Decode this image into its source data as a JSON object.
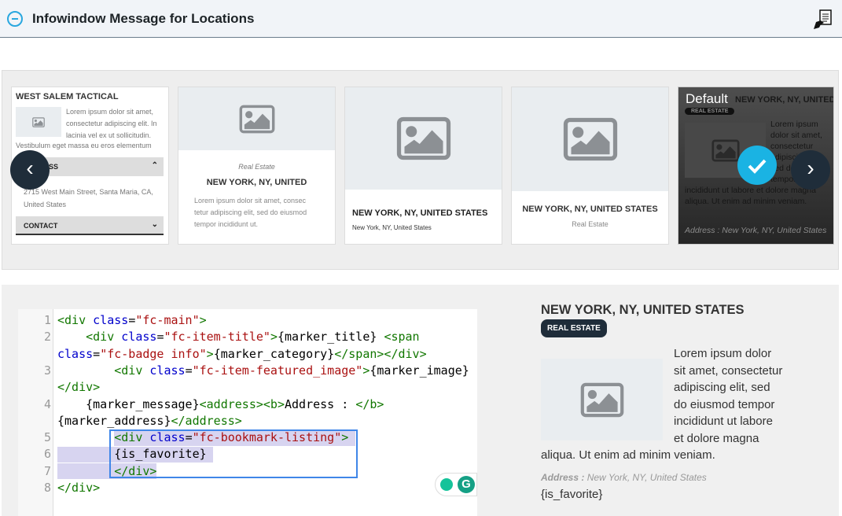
{
  "header": {
    "title": "Infowindow Message for Locations",
    "collapse_icon": "minus-circle-icon",
    "action_icon": "document-hand-icon"
  },
  "carousel": {
    "cards": [
      {
        "title": "WEST SALEM TACTICAL",
        "message": "Lorem ipsum dolor sit amet, consectetur adipiscing elit. In lacinia vel ex ut sollicitudin.",
        "message_cont": "Vestibulum eget massa eu eros elementum",
        "section1": "ADDRESS",
        "address": "2715 West Main Street, Santa Maria, CA, United States",
        "section2": "CONTACT"
      },
      {
        "category": "Real Estate",
        "title": "NEW YORK, NY, UNITED",
        "message": "Lorem ipsum dolor sit amet, consec tetur adipiscing elit, sed do eiusmod tempor incididunt ut."
      },
      {
        "title": "NEW YORK, NY, UNITED STATES",
        "address": "New York, NY, United States"
      },
      {
        "title": "NEW YORK, NY, UNITED STATES",
        "category": "Real Estate"
      },
      {
        "label": "Default",
        "title": "NEW YORK, NY, UNITED STATES",
        "badge": "REAL ESTATE",
        "message": "Lorem ipsum dolor sit amet, consectetur adipiscing elit, sed do eiusmod tempor incididunt ut labore et dolore magna aliqua. Ut enim ad minim veniam.",
        "address": "Address : New York, NY, United States",
        "selected": true
      }
    ],
    "prev_icon": "chevron-left-icon",
    "next_icon": "chevron-right-icon",
    "check_icon": "check-icon",
    "accent": "#1ab3e3"
  },
  "editor": {
    "lines": [
      {
        "n": "1",
        "rows": [
          [
            [
              "tg",
              "<div "
            ],
            [
              "at",
              "class"
            ],
            [
              "tx",
              "="
            ],
            [
              "st",
              "\"fc-main\""
            ],
            [
              "tg",
              ">"
            ]
          ]
        ]
      },
      {
        "n": "2",
        "rows": [
          [
            [
              "tx",
              "    "
            ],
            [
              "tg",
              "<div "
            ],
            [
              "at",
              "class"
            ],
            [
              "tx",
              "="
            ],
            [
              "st",
              "\"fc-item-title\""
            ],
            [
              "tg",
              ">"
            ],
            [
              "tx",
              "{marker_title} "
            ],
            [
              "tg",
              "<span"
            ]
          ],
          [
            [
              "at",
              "class"
            ],
            [
              "tx",
              "="
            ],
            [
              "st",
              "\"fc-badge info\""
            ],
            [
              "tg",
              ">"
            ],
            [
              "tx",
              "{marker_category}"
            ],
            [
              "tg",
              "</span></div>"
            ]
          ]
        ]
      },
      {
        "n": "3",
        "rows": [
          [
            [
              "tx",
              "        "
            ],
            [
              "tg",
              "<div "
            ],
            [
              "at",
              "class"
            ],
            [
              "tx",
              "="
            ],
            [
              "st",
              "\"fc-item-featured_image\""
            ],
            [
              "tg",
              ">"
            ],
            [
              "tx",
              "{marker_image}"
            ]
          ],
          [
            [
              "tg",
              "</div>"
            ]
          ]
        ]
      },
      {
        "n": "4",
        "rows": [
          [
            [
              "tx",
              "    {marker_message}"
            ],
            [
              "tg",
              "<address><b>"
            ],
            [
              "tx",
              "Address : "
            ],
            [
              "tg",
              "</b>"
            ]
          ],
          [
            [
              "tx",
              "{marker_address}"
            ],
            [
              "tg",
              "</address>"
            ]
          ]
        ]
      },
      {
        "n": "5",
        "rows": [
          [
            [
              "tx",
              "        "
            ],
            [
              "tg",
              "<div "
            ],
            [
              "at",
              "class"
            ],
            [
              "tx",
              "="
            ],
            [
              "st",
              "\"fc-bookmark-listing\""
            ],
            [
              "tg",
              ">"
            ]
          ]
        ]
      },
      {
        "n": "6",
        "rows": [
          [
            [
              "tx",
              "        {is_favorite}"
            ]
          ]
        ]
      },
      {
        "n": "7",
        "rows": [
          [
            [
              "tx",
              "        "
            ],
            [
              "tg",
              "</div>"
            ]
          ]
        ]
      },
      {
        "n": "8",
        "rows": [
          [
            [
              "tg",
              "</div>"
            ]
          ]
        ]
      }
    ]
  },
  "preview": {
    "title": "NEW YORK, NY, UNITED STATES",
    "badge": "REAL ESTATE",
    "message": "Lorem ipsum dolor sit amet, consectetur adipiscing elit, sed do eiusmod tempor incididunt ut labore et dolore magna aliqua. Ut enim ad minim veniam.",
    "address_label": "Address :",
    "address": "New York, NY, United States",
    "favorite": "{is_favorite}"
  }
}
